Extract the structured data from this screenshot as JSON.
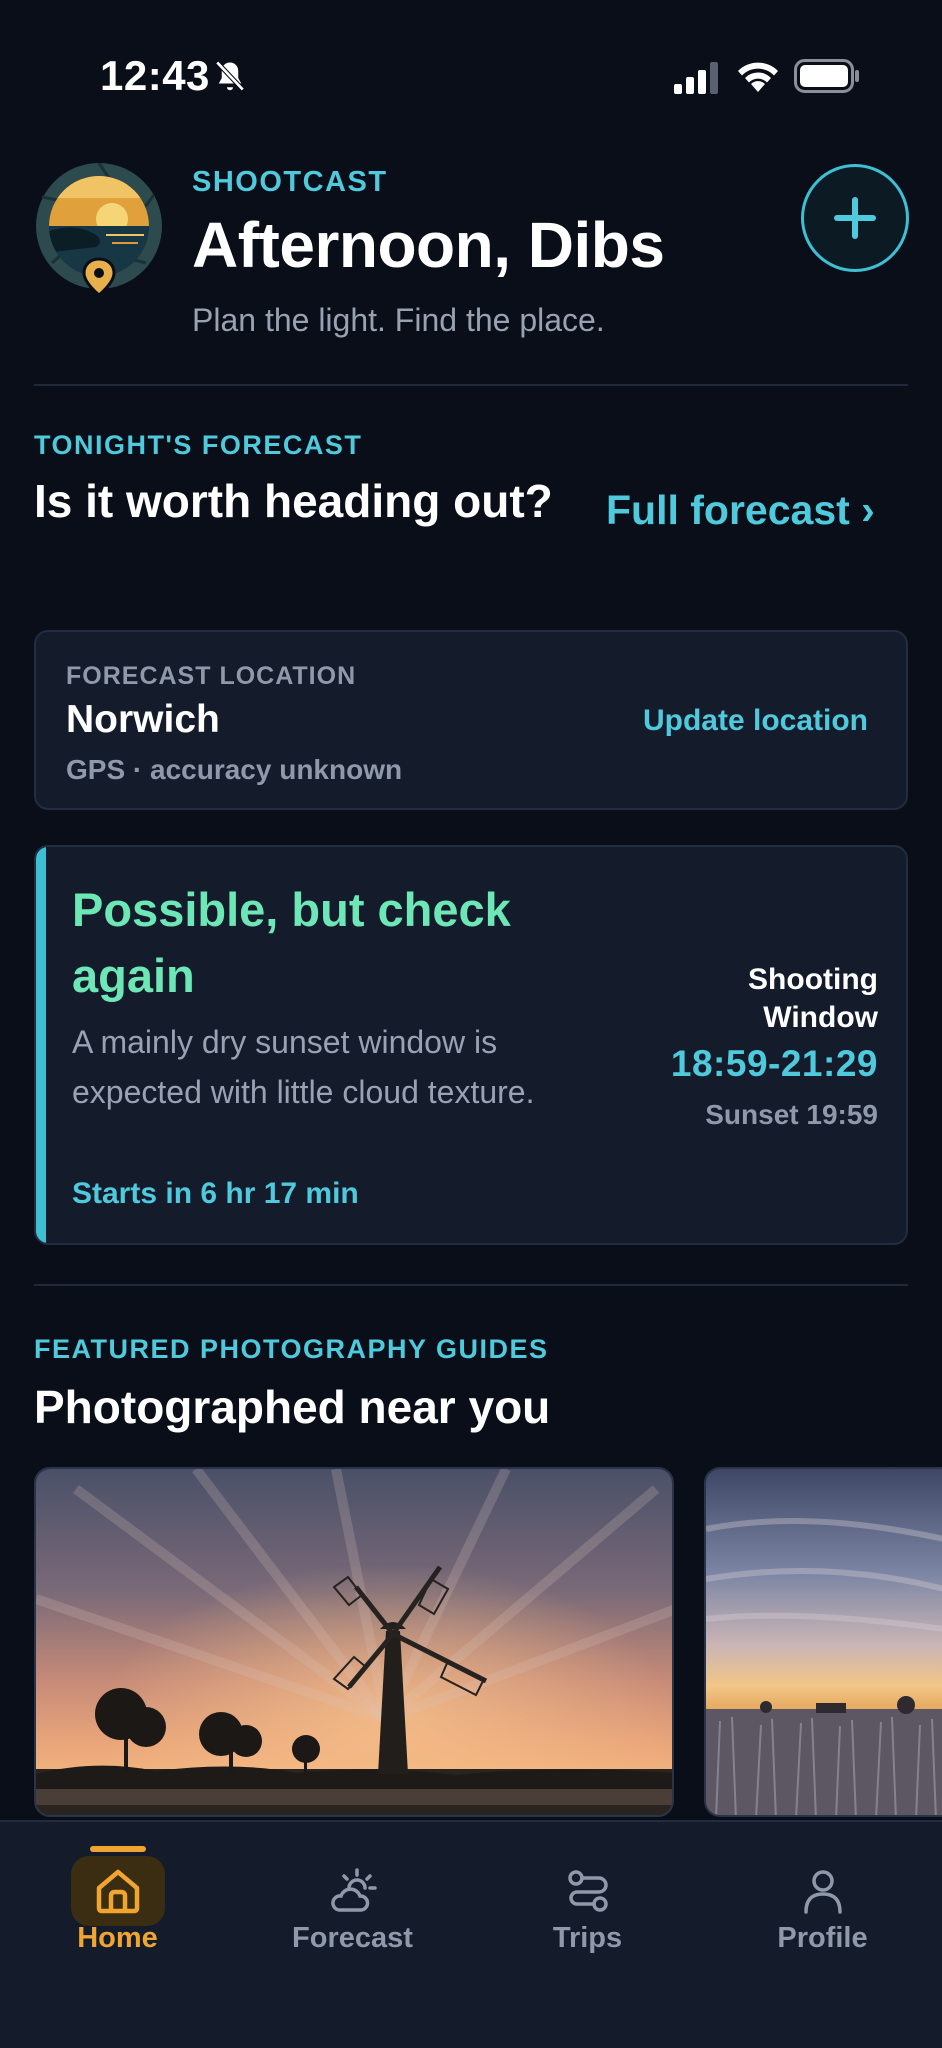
{
  "status_bar": {
    "time": "12:43",
    "icons": [
      "bell-slash-icon",
      "cellular-signal-icon",
      "wifi-icon",
      "battery-icon"
    ]
  },
  "header": {
    "brand": "SHOOTCAST",
    "greeting": "Afternoon, Dibs",
    "tagline": "Plan the light. Find the place.",
    "logo_icon": "aperture-sunset-pin-logo",
    "add_icon": "plus-icon"
  },
  "forecast_section": {
    "eyebrow": "TONIGHT'S FORECAST",
    "heading": "Is it worth heading out?",
    "full_forecast_link": "Full forecast ›"
  },
  "location_card": {
    "eyebrow": "FORECAST LOCATION",
    "name": "Norwich",
    "accuracy": "GPS · accuracy unknown",
    "update_label": "Update location"
  },
  "verdict_card": {
    "title": "Possible, but check again",
    "description": "A mainly dry sunset window is expected with little cloud texture.",
    "countdown": "Starts in 6 hr 17 min",
    "window_label": "Shooting Window",
    "window_time": "18:59-21:29",
    "sunset": "Sunset 19:59"
  },
  "guides_section": {
    "eyebrow": "FEATURED PHOTOGRAPHY GUIDES",
    "heading": "Photographed near you"
  },
  "tab_bar": {
    "tabs": [
      {
        "label": "Home",
        "icon": "home-icon",
        "active": true
      },
      {
        "label": "Forecast",
        "icon": "sun-cloud-icon",
        "active": false
      },
      {
        "label": "Trips",
        "icon": "route-icon",
        "active": false
      },
      {
        "label": "Profile",
        "icon": "person-icon",
        "active": false
      }
    ]
  },
  "colors": {
    "background": "#0a0e18",
    "card": "#141c2c",
    "accent_cyan": "#4fc9dc",
    "verdict_green": "#6ee7b7",
    "active_tab_amber": "#f0a531",
    "muted_text": "#8f99aa"
  }
}
